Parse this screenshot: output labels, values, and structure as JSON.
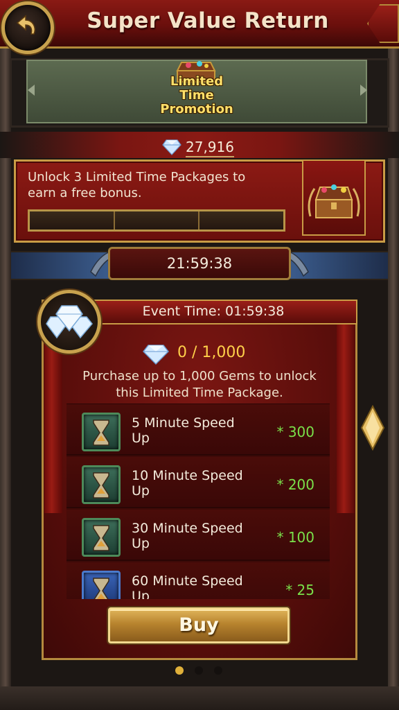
{
  "header": {
    "title": "Super Value Return",
    "back_icon": "back-arrow-icon"
  },
  "promotion": {
    "label_lines": [
      "Limited",
      "Time",
      "Promotion"
    ],
    "icon": "treasure-chest-icon"
  },
  "balance": {
    "gem_icon": "diamond-icon",
    "value": "27,916"
  },
  "unlock": {
    "text_lines": [
      "Unlock 3 Limited Time Packages to",
      "earn a free bonus."
    ],
    "progress": {
      "completed": 0,
      "total": 3
    },
    "reward_icon": "treasure-chest-icon"
  },
  "countdown": {
    "value": "21:59:38"
  },
  "package": {
    "event_time": "Event Time: 01:59:38",
    "gem_progress": "0 / 1,000",
    "description_lines": [
      "Purchase up to 1,000 Gems to unlock",
      "this Limited Time Package."
    ],
    "items": [
      {
        "name_lines": [
          "5 Minute Speed",
          "Up"
        ],
        "quantity": "* 300",
        "icon": "hourglass-icon",
        "tier": "green"
      },
      {
        "name_lines": [
          "10 Minute Speed",
          "Up"
        ],
        "quantity": "* 200",
        "icon": "hourglass-icon",
        "tier": "green"
      },
      {
        "name_lines": [
          "30 Minute Speed",
          "Up"
        ],
        "quantity": "* 100",
        "icon": "hourglass-icon",
        "tier": "green"
      },
      {
        "name_lines": [
          "60 Minute Speed",
          "Up"
        ],
        "quantity": "* 25",
        "icon": "hourglass-icon",
        "tier": "blue"
      }
    ],
    "buy_label": "Buy"
  },
  "pagination": {
    "pages": 3,
    "active": 1
  },
  "colors": {
    "header_red": "#8a1a14",
    "gold": "#c99c45",
    "quantity_green": "#7ae04a",
    "gem_progress_yellow": "#ffd04a"
  }
}
